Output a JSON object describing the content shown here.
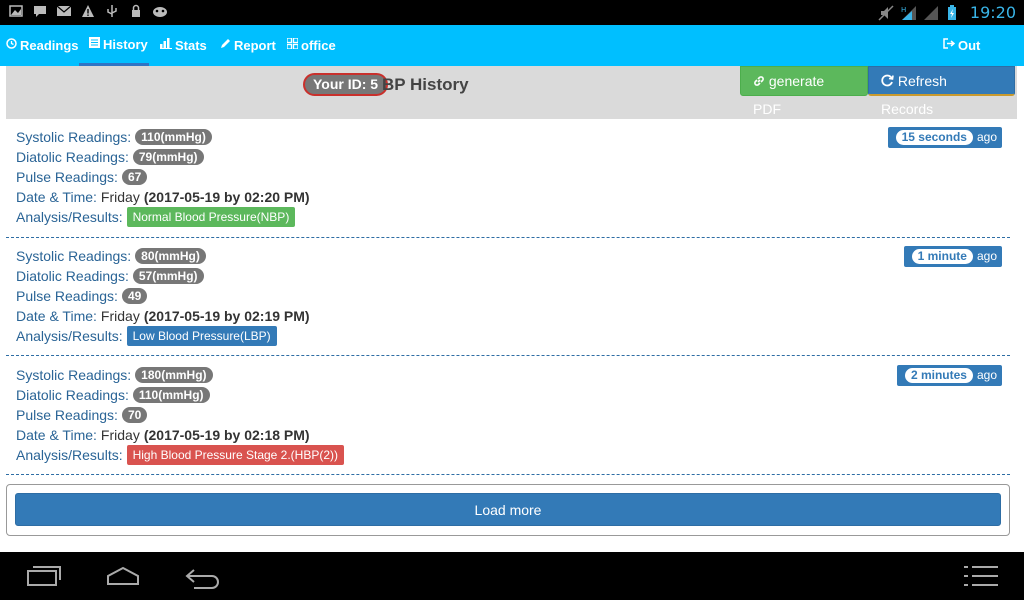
{
  "status": {
    "time": "19:20",
    "left_icons": [
      "image-icon",
      "chat-icon",
      "mail-icon",
      "warning-icon",
      "usb-icon",
      "lock-icon",
      "android-icon"
    ],
    "right_icons": [
      "mute-icon",
      "signal-h-icon",
      "signal-icon",
      "battery-icon"
    ]
  },
  "nav": {
    "readings": "Readings",
    "history": "History",
    "stats": "Stats",
    "report": "Report",
    "office": "office",
    "out": "Out"
  },
  "header": {
    "id_badge": "Your ID: 5",
    "title": "BP History",
    "pdf_button": "generate PDF",
    "refresh_button": "Refresh Records"
  },
  "labels": {
    "systolic": "Systolic Readings:",
    "diastolic": "Diatolic Readings:",
    "pulse": "Pulse Readings:",
    "datetime": "Date & Time:",
    "analysis": "Analysis/Results:",
    "ago": "ago"
  },
  "records": [
    {
      "systolic": "110(mmHg)",
      "diastolic": "79(mmHg)",
      "pulse": "67",
      "day": "Friday",
      "datetime": "(2017-05-19 by 02:20 PM)",
      "result": "Normal Blood Pressure(NBP)",
      "result_color": "#5cb85c",
      "time_ago": "15 seconds"
    },
    {
      "systolic": "80(mmHg)",
      "diastolic": "57(mmHg)",
      "pulse": "49",
      "day": "Friday",
      "datetime": "(2017-05-19 by 02:19 PM)",
      "result": "Low Blood Pressure(LBP)",
      "result_color": "#337ab7",
      "time_ago": "1 minute"
    },
    {
      "systolic": "180(mmHg)",
      "diastolic": "110(mmHg)",
      "pulse": "70",
      "day": "Friday",
      "datetime": "(2017-05-19 by 02:18 PM)",
      "result": "High Blood Pressure Stage 2.(HBP(2))",
      "result_color": "#d9534f",
      "time_ago": "2 minutes"
    }
  ],
  "load_more": "Load more",
  "colors": {
    "nav_bg": "#00bfff",
    "primary": "#337ab7",
    "success": "#5cb85c",
    "danger": "#d9534f"
  }
}
